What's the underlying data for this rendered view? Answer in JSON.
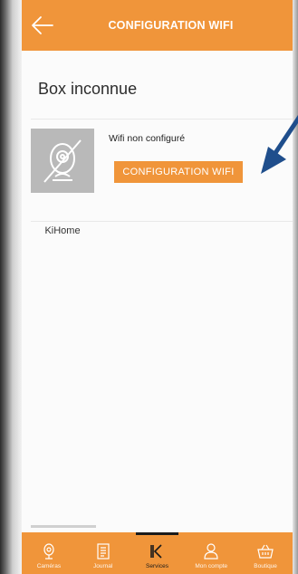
{
  "header": {
    "title": "CONFIGURATION WIFI",
    "back_icon": "arrow-left-icon"
  },
  "section": {
    "title": "Box inconnue"
  },
  "device": {
    "name": "KiHome",
    "status": "Wifi non configuré",
    "button_label": "CONFIGURATION WIFI",
    "thumbnail_icon": "camera-off-icon"
  },
  "tabbar": {
    "active": "Services",
    "items": [
      {
        "label": "Caméras",
        "icon": "camera-icon"
      },
      {
        "label": "Journal",
        "icon": "journal-icon"
      },
      {
        "label": "Services",
        "icon": "services-k-icon"
      },
      {
        "label": "Mon compte",
        "icon": "user-icon"
      },
      {
        "label": "Boutique",
        "icon": "basket-icon"
      }
    ]
  },
  "colors": {
    "accent": "#f0953a",
    "arrow": "#1f4e8c",
    "thumbnail_bg": "#b9b9b9"
  }
}
